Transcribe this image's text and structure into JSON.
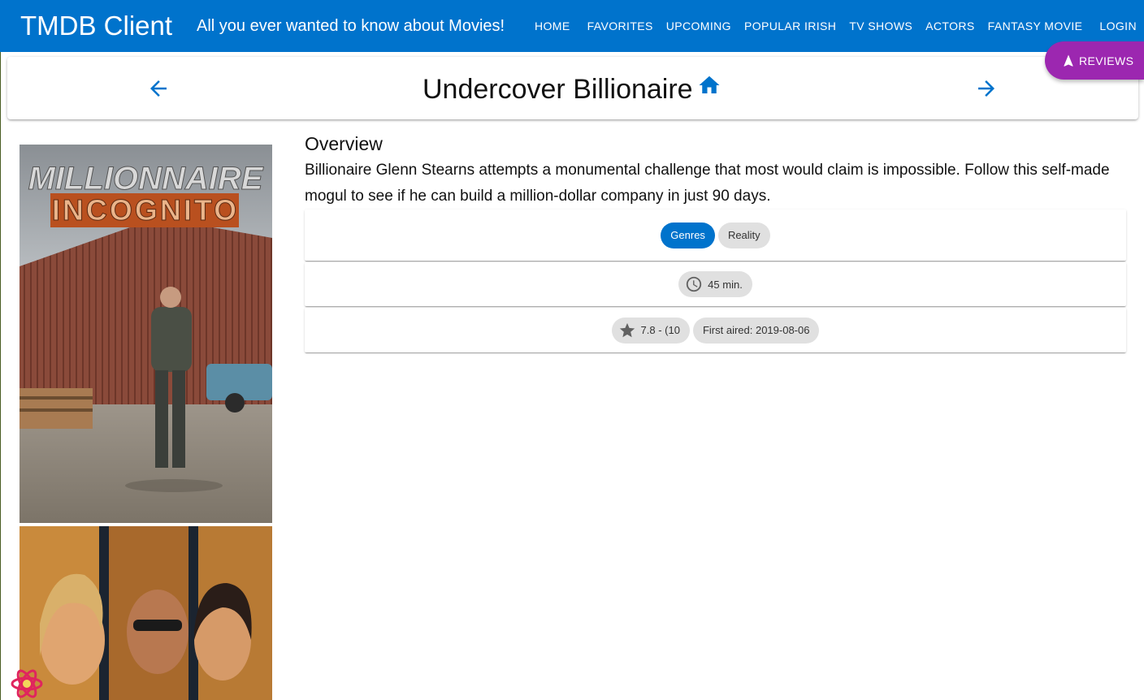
{
  "app": {
    "brand": "TMDB Client",
    "tagline": "All you ever wanted to know about Movies!",
    "nav": [
      "HOME",
      "FAVORITES",
      "UPCOMING",
      "POPULAR IRISH",
      "TV SHOWS",
      "ACTORS",
      "FANTASY MOVIE",
      "LOGIN"
    ]
  },
  "header": {
    "title": "Undercover Billionaire"
  },
  "reviews_button": "REVIEWS",
  "overview": {
    "heading": "Overview",
    "text": "Billionaire Glenn Stearns attempts a monumental challenge that most would claim is impossible. Follow this self-made mogul to see if he can build a million-dollar company in just 90 days."
  },
  "posters": {
    "first_title_line1": "MILLIONNAIRE",
    "first_title_line2": "INCOGNITO"
  },
  "details": {
    "genres_label": "Genres",
    "genres": [
      "Reality"
    ],
    "runtime": "45 min.",
    "rating": "7.8 - (10",
    "first_aired": "First aired: 2019-08-06"
  },
  "colors": {
    "primary": "#0073cc",
    "secondary": "#9c27b0",
    "chip": "#e0e0e0"
  }
}
